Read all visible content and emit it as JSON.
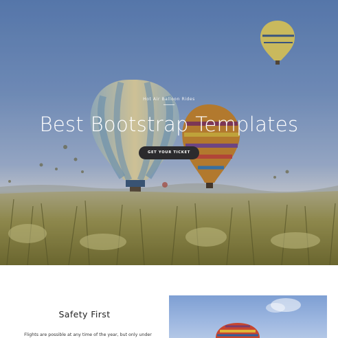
{
  "hero": {
    "subtitle": "Hot Air Balloon Rides",
    "title": "Best Bootstrap Templates",
    "cta_label": "GET YOUR TICKET"
  },
  "feature": {
    "title": "Safety First",
    "text": "Flights are possible at any time of the year, but only under"
  },
  "colors": {
    "button_bg": "#2b2a2d",
    "title_color": "#ffffff",
    "sky": "#7b98c7"
  }
}
